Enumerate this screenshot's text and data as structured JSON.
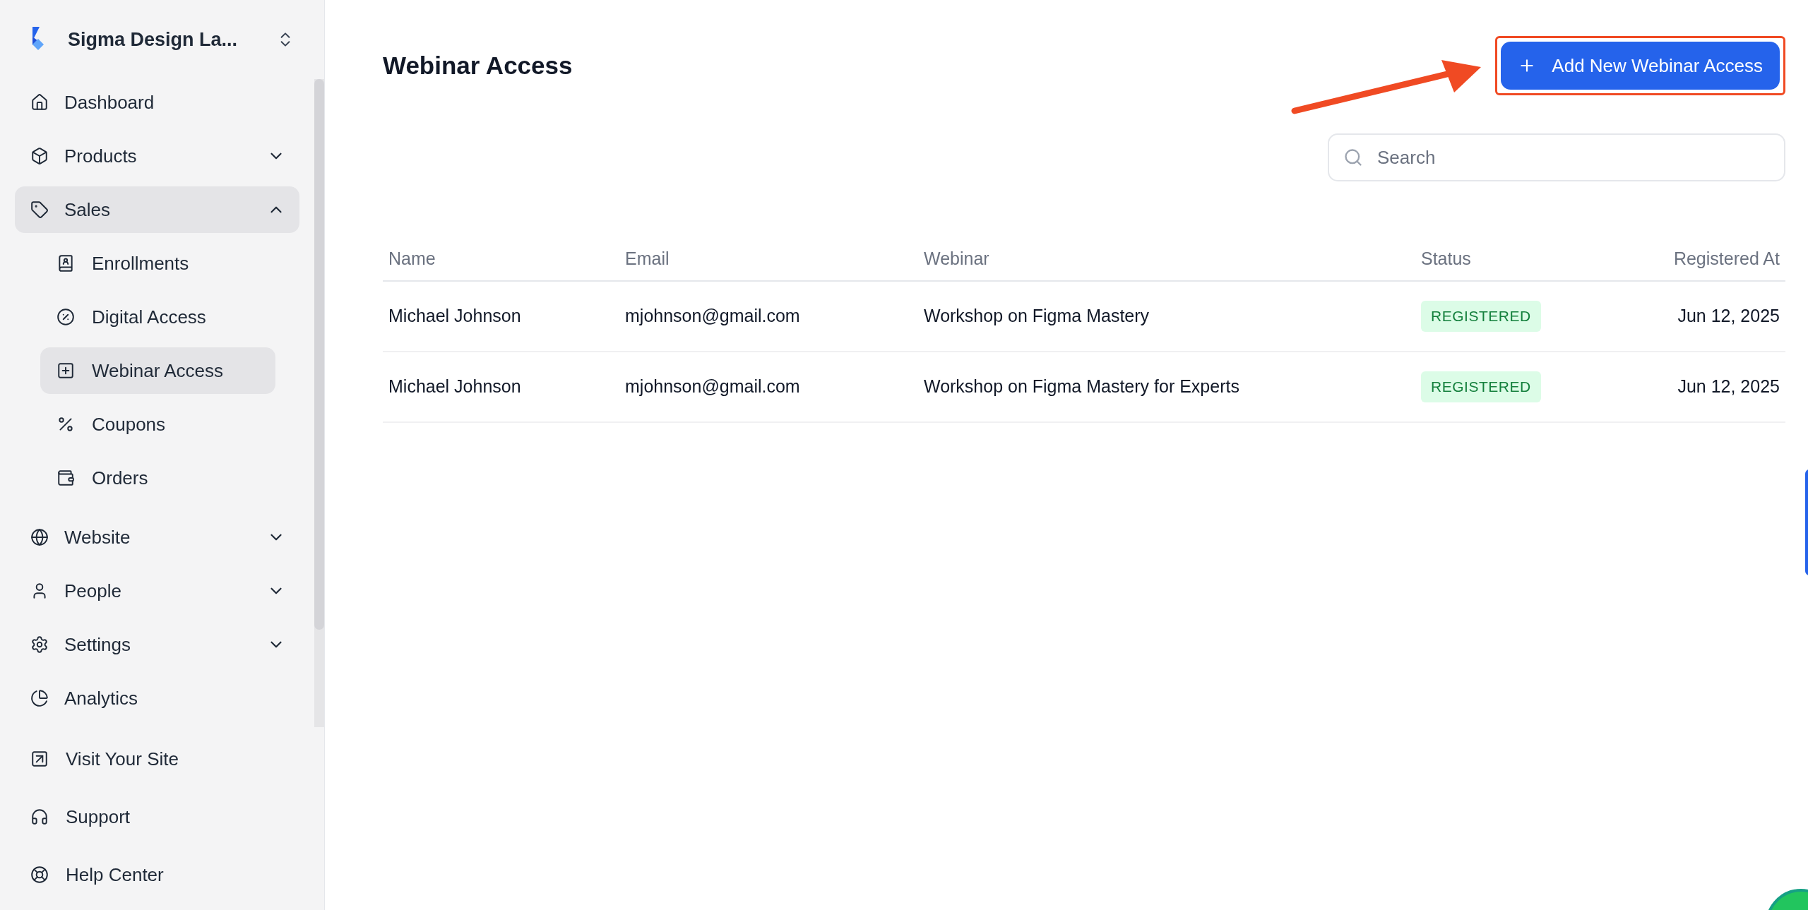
{
  "workspace": {
    "name": "Sigma Design La..."
  },
  "nav": [
    {
      "label": "Dashboard",
      "kind": "link",
      "selected": false
    },
    {
      "label": "Products",
      "kind": "group",
      "expanded": false,
      "selected": false
    },
    {
      "label": "Sales",
      "kind": "group",
      "expanded": true,
      "selected": true,
      "children": [
        {
          "label": "Enrollments",
          "selected": false
        },
        {
          "label": "Digital Access",
          "selected": false
        },
        {
          "label": "Webinar Access",
          "selected": true
        },
        {
          "label": "Coupons",
          "selected": false
        },
        {
          "label": "Orders",
          "selected": false
        }
      ]
    },
    {
      "label": "Website",
      "kind": "group",
      "expanded": false,
      "selected": false
    },
    {
      "label": "People",
      "kind": "group",
      "expanded": false,
      "selected": false
    },
    {
      "label": "Settings",
      "kind": "group",
      "expanded": false,
      "selected": false
    },
    {
      "label": "Analytics",
      "kind": "link",
      "selected": false
    }
  ],
  "footer_links": [
    "Visit Your Site",
    "Support",
    "Help Center"
  ],
  "page": {
    "title": "Webinar Access"
  },
  "add_button": {
    "label": "Add New Webinar Access"
  },
  "search": {
    "placeholder": "Search"
  },
  "table": {
    "columns": [
      "Name",
      "Email",
      "Webinar",
      "Status",
      "Registered At"
    ],
    "rows": [
      {
        "cells": [
          "Michael Johnson",
          "mjohnson@gmail.com",
          "Workshop on Figma Mastery",
          "REGISTERED",
          "Jun 12, 2025"
        ]
      },
      {
        "cells": [
          "Michael Johnson",
          "mjohnson@gmail.com",
          "Workshop on Figma Mastery for Experts",
          "REGISTERED",
          "Jun 12, 2025"
        ]
      }
    ]
  }
}
